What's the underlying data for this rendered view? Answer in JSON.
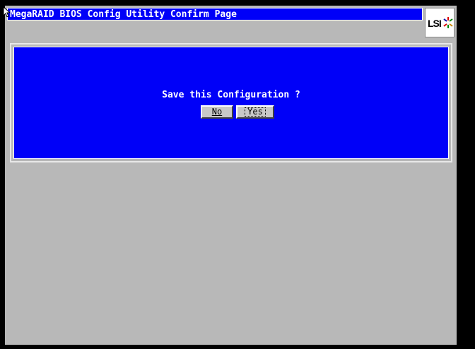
{
  "window": {
    "title": "MegaRAID BIOS Config Utility  Confirm Page",
    "logo_text": "LSI"
  },
  "dialog": {
    "question": "Save this Configuration ?",
    "no_label": "No",
    "yes_label": "Yes",
    "focused_button": "Yes"
  },
  "colors": {
    "panel_blue": "#0000f8",
    "background_gray": "#b8b8b8"
  }
}
